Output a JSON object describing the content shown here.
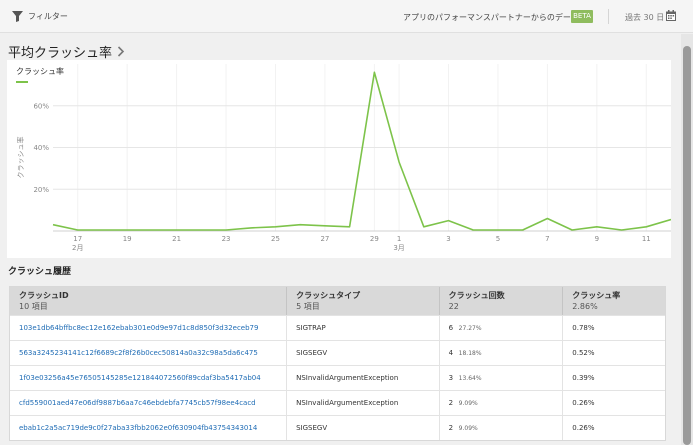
{
  "toolbar": {
    "filter_label": "フィルター",
    "partner_label": "アプリのパフォーマンスパートナーからのデータ",
    "beta_label": "BETA",
    "date_range": "過去 30 日"
  },
  "section": {
    "title": "平均クラッシュ率"
  },
  "chart_panel": {
    "legend": "クラッシュ率"
  },
  "chart_data": {
    "type": "line",
    "ylabel": "クラッシュ率",
    "y_ticks": [
      "20%",
      "40%",
      "60%"
    ],
    "ylim": [
      0,
      80
    ],
    "x_tick_labels": [
      "17",
      "19",
      "21",
      "23",
      "25",
      "27",
      "29",
      "1",
      "3",
      "5",
      "7",
      "9",
      "11"
    ],
    "x_month_labels": [
      {
        "at": "17",
        "label": "2月"
      },
      {
        "at": "1",
        "label": "3月"
      }
    ],
    "days": [
      "16",
      "17",
      "18",
      "19",
      "20",
      "21",
      "22",
      "23",
      "24",
      "25",
      "26",
      "27",
      "28",
      "29",
      "1",
      "2",
      "3",
      "4",
      "5",
      "6",
      "7",
      "8",
      "9",
      "10",
      "11",
      "12"
    ],
    "series": [
      {
        "color": "#7dc34a",
        "values": [
          3,
          0.5,
          0.5,
          0.5,
          0.5,
          0.5,
          0.5,
          0.5,
          1.5,
          2,
          3,
          2.5,
          2,
          76,
          33,
          2,
          5,
          0.5,
          0.5,
          0.5,
          6,
          0.5,
          2,
          0.5,
          2,
          5.5
        ]
      }
    ],
    "grid": "horizontal"
  },
  "history": {
    "title": "クラッシュ履歴"
  },
  "table": {
    "columns": [
      {
        "title": "クラッシュID",
        "summary": "10 項目"
      },
      {
        "title": "クラッシュタイプ",
        "summary": "5 項目"
      },
      {
        "title": "クラッシュ回数",
        "summary": "22"
      },
      {
        "title": "クラッシュ率",
        "summary": "2.86%"
      }
    ],
    "rows": [
      {
        "id": "103e1db64bffbc8ec12e162ebab301e0d9e97d1c8d850f3d32eceb79",
        "type": "SIGTRAP",
        "count": "6",
        "share": "27.27%",
        "rate": "0.78%"
      },
      {
        "id": "563a3245234141c12f6689c2f8f26b0cec50814a0a32c98a5da6c475",
        "type": "SIGSEGV",
        "count": "4",
        "share": "18.18%",
        "rate": "0.52%"
      },
      {
        "id": "1f03e03256a45e76505145285e121844072560f89cdaf3ba5417ab04",
        "type": "NSInvalidArgumentException",
        "count": "3",
        "share": "13.64%",
        "rate": "0.39%"
      },
      {
        "id": "cfd559001aed47e06df9887b6aa7c46ebdebfa7745cb57f98ee4cacd",
        "type": "NSInvalidArgumentException",
        "count": "2",
        "share": "9.09%",
        "rate": "0.26%"
      },
      {
        "id": "ebab1c2a5ac719de9c0f27aba33fbb2062e0f630904fb43754343014",
        "type": "SIGSEGV",
        "count": "2",
        "share": "9.09%",
        "rate": "0.26%"
      }
    ]
  },
  "colors": {
    "accent": "#7dc34a",
    "beta_badge": "#8fbc5e",
    "link": "#1f6cb5",
    "table_header": "#d9d9d9"
  },
  "icons": {
    "filter": "filter-icon",
    "chevron": "chevron-right-icon",
    "calendar": "calendar-icon"
  }
}
